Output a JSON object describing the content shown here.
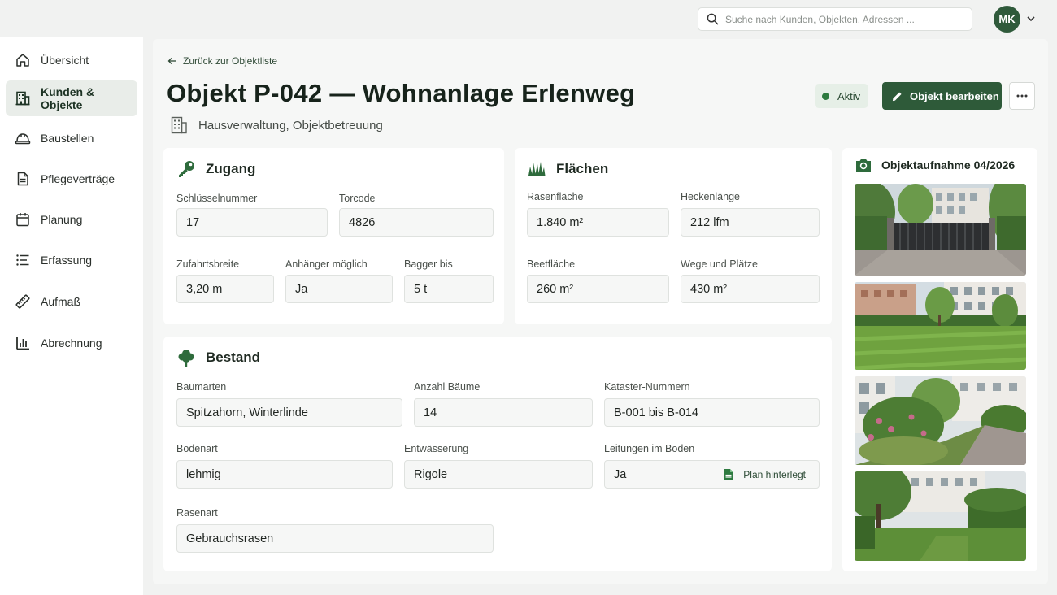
{
  "search": {
    "placeholder": "Suche nach Kunden, Objekten, Adressen ..."
  },
  "user": {
    "initials": "MK"
  },
  "sidebar": {
    "items": [
      {
        "label": "Übersicht",
        "icon": "home-icon",
        "active": false
      },
      {
        "label": "Kunden & Objekte",
        "icon": "building-icon",
        "active": true
      },
      {
        "label": "Baustellen",
        "icon": "helmet-icon",
        "active": false
      },
      {
        "label": "Pflegeverträge",
        "icon": "document-icon",
        "active": false
      },
      {
        "label": "Planung",
        "icon": "calendar-icon",
        "active": false
      },
      {
        "label": "Erfassung",
        "icon": "list-icon",
        "active": false
      },
      {
        "label": "Aufmaß",
        "icon": "ruler-icon",
        "active": false
      },
      {
        "label": "Abrechnung",
        "icon": "bar-chart-icon",
        "active": false
      }
    ]
  },
  "header": {
    "back_label": "Zurück zur Objektliste",
    "title": "Objekt P-042 — Wohnanlage Erlenweg",
    "subtitle": "Hausverwaltung, Objektbetreuung",
    "status": "Aktiv",
    "edit_label": "Objekt bearbeiten"
  },
  "zugang": {
    "title": "Zugang",
    "schluessel_label": "Schlüsselnummer",
    "schluessel_value": "17",
    "torcode_label": "Torcode",
    "torcode_value": "4826",
    "zufahrt_label": "Zufahrtsbreite",
    "zufahrt_value": "3,20 m",
    "anhaenger_label": "Anhänger möglich",
    "anhaenger_value": "Ja",
    "bagger_label": "Bagger bis",
    "bagger_value": "5 t"
  },
  "flaechen": {
    "title": "Flächen",
    "rasen_label": "Rasenfläche",
    "rasen_value": "1.840 m²",
    "hecke_label": "Heckenlänge",
    "hecke_value": "212 lfm",
    "beet_label": "Beetfläche",
    "beet_value": "260 m²",
    "wege_label": "Wege und Plätze",
    "wege_value": "430 m²"
  },
  "bestand": {
    "title": "Bestand",
    "baumarten_label": "Baumarten",
    "baumarten_value": "Spitzahorn, Winterlinde",
    "anzahl_label": "Anzahl Bäume",
    "anzahl_value": "14",
    "kataster_label": "Kataster-Nummern",
    "kataster_value": "B-001 bis B-014",
    "boden_label": "Bodenart",
    "boden_value": "lehmig",
    "entwaesserung_label": "Entwässerung",
    "entwaesserung_value": "Rigole",
    "leitungen_label": "Leitungen im Boden",
    "leitungen_value": "Ja",
    "plan_note": "Plan hinterlegt",
    "rasenart_label": "Rasenart",
    "rasenart_value": "Gebrauchsrasen"
  },
  "photos": {
    "title": "Objektaufnahme 04/2026"
  },
  "colors": {
    "primary": "#2e5a39",
    "status_dot": "#2c7a3f",
    "sidebar_active": "#e9ede9"
  }
}
